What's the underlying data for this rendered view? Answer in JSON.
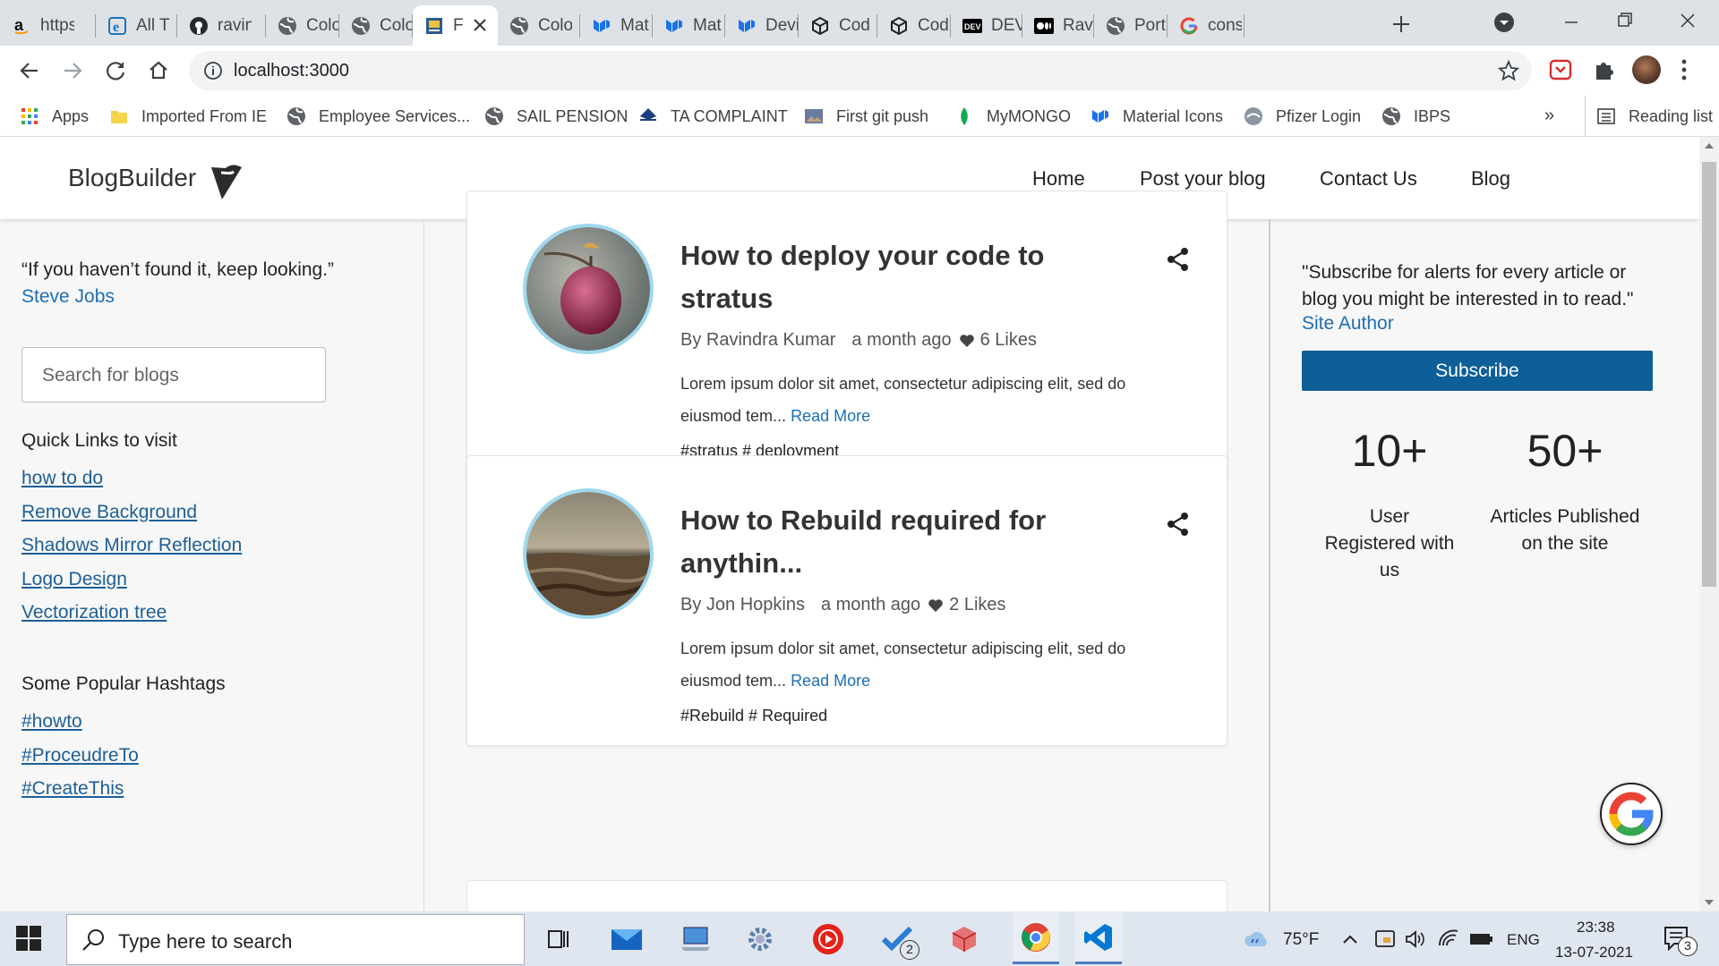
{
  "browser": {
    "tabs": [
      {
        "title": "https",
        "icon": "amazon-icon"
      },
      {
        "title": "All T",
        "icon": "ie-icon"
      },
      {
        "title": "ravin",
        "icon": "github-icon"
      },
      {
        "title": "Colo",
        "icon": "globe-icon"
      },
      {
        "title": "Colo",
        "icon": "globe-icon"
      },
      {
        "title": "F",
        "icon": "page-icon",
        "active": true
      },
      {
        "title": "Colo",
        "icon": "globe-icon"
      },
      {
        "title": "Mat",
        "icon": "mui-icon"
      },
      {
        "title": "Mat",
        "icon": "mui-icon"
      },
      {
        "title": "Devi",
        "icon": "mui-icon"
      },
      {
        "title": "Cod",
        "icon": "codesandbox-icon"
      },
      {
        "title": "Cod",
        "icon": "codesandbox-icon"
      },
      {
        "title": "DEV",
        "icon": "dev-icon"
      },
      {
        "title": "Ravi",
        "icon": "medium-icon"
      },
      {
        "title": "Port",
        "icon": "globe-icon"
      },
      {
        "title": "cons",
        "icon": "google-icon"
      }
    ],
    "url": "localhost:3000",
    "bookmarks": [
      {
        "label": "Apps",
        "icon": "apps-grid-icon"
      },
      {
        "label": "Imported From IE",
        "icon": "folder-icon"
      },
      {
        "label": "Employee Services...",
        "icon": "globe-icon"
      },
      {
        "label": "SAIL PENSION",
        "icon": "globe-icon"
      },
      {
        "label": "TA COMPLAINT",
        "icon": "sail-icon"
      },
      {
        "label": "First git push",
        "icon": "image-icon"
      },
      {
        "label": "MyMONGO",
        "icon": "leaf-icon"
      },
      {
        "label": "Material Icons",
        "icon": "mui-icon"
      },
      {
        "label": "Pfizer Login",
        "icon": "pfizer-icon"
      },
      {
        "label": "IBPS",
        "icon": "globe-icon"
      }
    ],
    "overflow": "»",
    "reading_list": "Reading list"
  },
  "site": {
    "brand": "BlogBuilder",
    "nav": [
      "Home",
      "Post your blog",
      "Contact Us",
      "Blog"
    ],
    "quote": {
      "text": "“If you haven’t found it, keep looking.”",
      "author": "Steve Jobs"
    },
    "search_placeholder": "Search for blogs",
    "quick_links_title": "Quick Links to visit",
    "quick_links": [
      "how to do",
      "Remove Background",
      "Shadows Mirror Reflection",
      "Logo Design",
      "Vectorization tree"
    ],
    "hashtags_title": "Some Popular Hashtags",
    "hashtags": [
      "#howto",
      "#ProceudreTo",
      "#CreateThis"
    ],
    "posts": [
      {
        "title": "How to deploy your code to stratus",
        "author": "By Ravindra Kumar",
        "time": "a month ago",
        "likes": "6 Likes",
        "excerpt": "Lorem ipsum dolor sit amet, consectetur adipiscing elit, sed do eiusmod tem...",
        "read_more": "Read More",
        "tags": "#stratus # deployment"
      },
      {
        "title": "How to Rebuild required for anythin...",
        "author": "By Jon Hopkins",
        "time": "a month ago",
        "likes": "2 Likes",
        "excerpt": "Lorem ipsum dolor sit amet, consectetur adipiscing elit, sed do eiusmod tem...",
        "read_more": "Read More",
        "tags": "#Rebuild # Required"
      }
    ],
    "subscribe": {
      "quote": "\"Subscribe for alerts for every article or blog you might be interested in to read.\"",
      "author": "Site Author",
      "button": "Subscribe"
    },
    "stats": [
      {
        "value": "10+",
        "label": "User Registered with us"
      },
      {
        "value": "50+",
        "label": "Articles Published on the site"
      }
    ]
  },
  "taskbar": {
    "search_placeholder": "Type here to search",
    "weather": "75°F",
    "lang": "ENG",
    "time": "23:38",
    "date": "13-07-2021",
    "todo_badge": "2",
    "notif_badge": "3"
  },
  "colors": {
    "accent": "#0e5f97",
    "link": "#1e6fb3",
    "avatar_ring": "#9fd8ef"
  }
}
